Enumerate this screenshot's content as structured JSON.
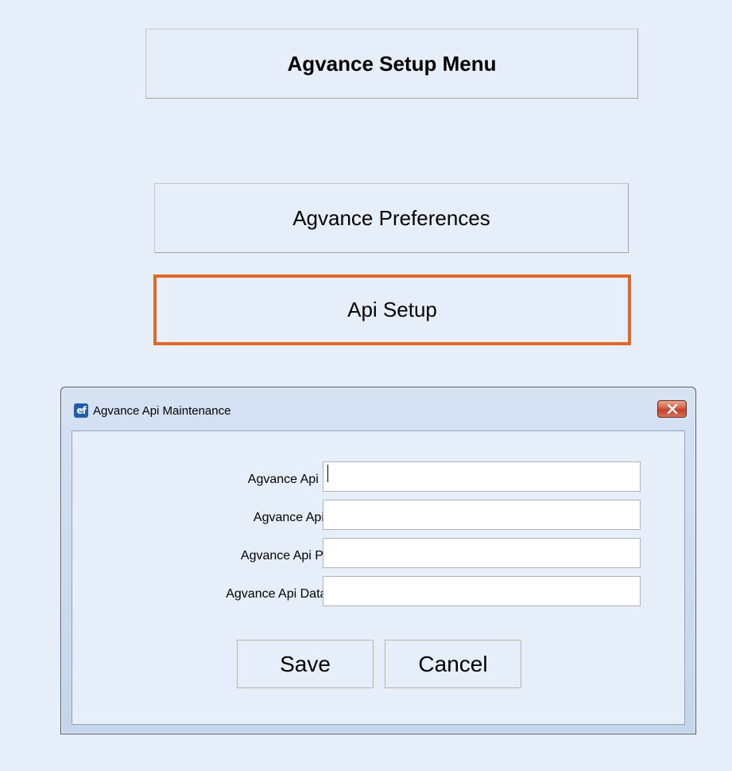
{
  "setup_menu": {
    "title": "Agvance Setup Menu",
    "preferences_label": "Agvance Preferences",
    "api_setup_label": "Api Setup",
    "highlight_color": "#e0692a"
  },
  "dialog": {
    "title": "Agvance Api Maintenance",
    "app_icon": "ef-app-icon",
    "close_icon": "close-icon",
    "fields": [
      {
        "label": "Agvance Api Base Url:",
        "value": "",
        "placeholder": ""
      },
      {
        "label": "Agvance Api User ID:",
        "value": "",
        "placeholder": ""
      },
      {
        "label": "Agvance Api Password:",
        "value": "",
        "placeholder": ""
      },
      {
        "label": "Agvance Api Database ID:",
        "value": "",
        "placeholder": ""
      }
    ],
    "save_label": "Save",
    "cancel_label": "Cancel"
  }
}
